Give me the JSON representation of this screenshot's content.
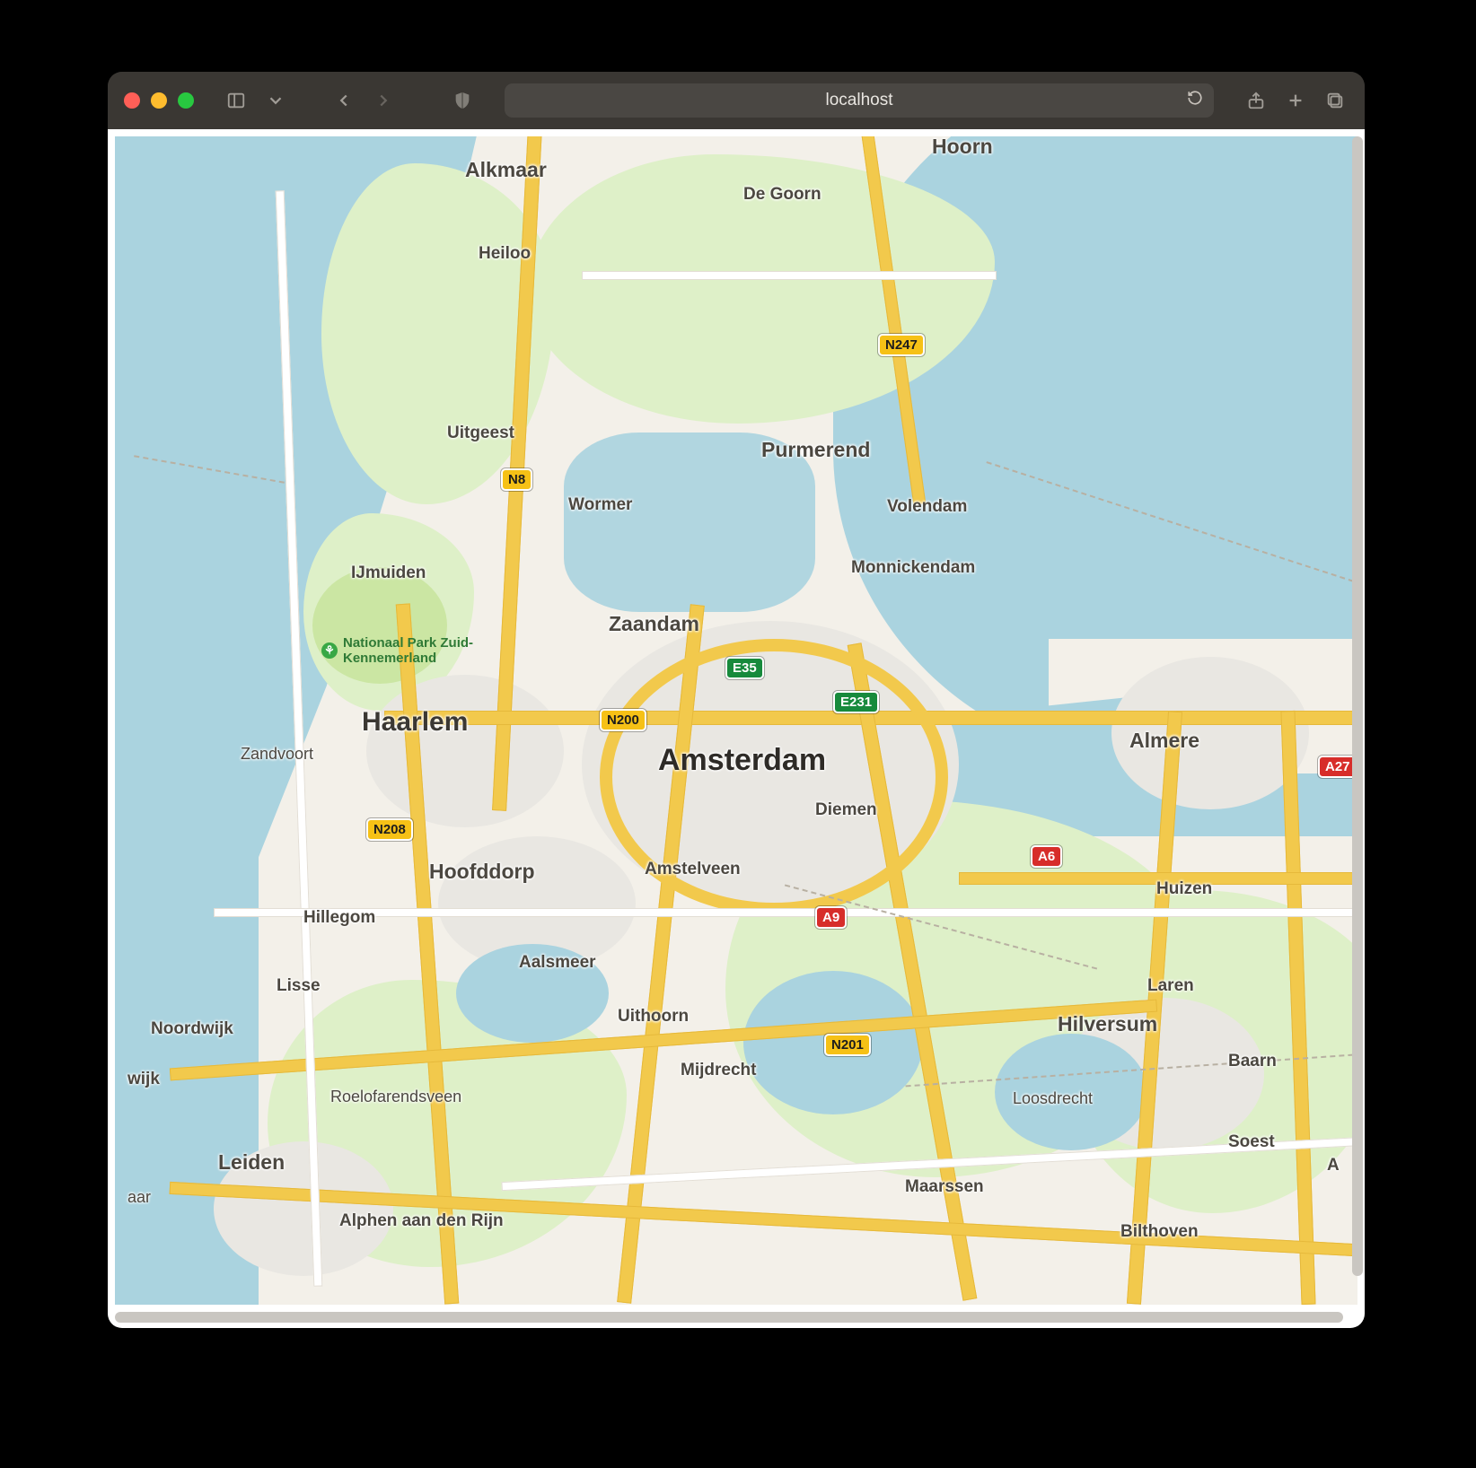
{
  "browser": {
    "address": "localhost",
    "traffic_lights": {
      "close": "close",
      "min": "minimize",
      "max": "maximize"
    }
  },
  "map": {
    "center_label": "Amsterdam",
    "poi": {
      "nationaal_park": "Nationaal Park Zuid-\nKennemerland"
    },
    "cities": {
      "amsterdam": "Amsterdam",
      "haarlem": "Haarlem",
      "almere": "Almere",
      "hilversum": "Hilversum",
      "leiden": "Leiden",
      "zaandam": "Zaandam",
      "purmerend": "Purmerend",
      "hoorn": "Hoorn",
      "alkmaar": "Alkmaar",
      "heiloo": "Heiloo",
      "uitgeest": "Uitgeest",
      "wormer": "Wormer",
      "degoorn": "De Goorn",
      "volendam": "Volendam",
      "monnickendam": "Monnickendam",
      "ijmuiden": "IJmuiden",
      "zandvoort": "Zandvoort",
      "hoofddorp": "Hoofddorp",
      "amstelveen": "Amstelveen",
      "diemen": "Diemen",
      "hillegom": "Hillegom",
      "lisse": "Lisse",
      "noordwijk": "Noordwijk",
      "wijk": "wijk",
      "aar": "aar",
      "roelofarendsveen": "Roelofarendsveen",
      "alphen": "Alphen aan den Rijn",
      "aalsmeer": "Aalsmeer",
      "uithoorn": "Uithoorn",
      "mijdrecht": "Mijdrecht",
      "maarssen": "Maarssen",
      "bilthoven": "Bilthoven",
      "soest": "Soest",
      "a_cut": "A",
      "baarn": "Baarn",
      "laren": "Laren",
      "huizen": "Huizen",
      "loosdrecht": "Loosdrecht",
      "n247": "N247",
      "n8": "N8",
      "n200": "N200",
      "n208": "N208",
      "n201": "N201",
      "e35": "E35",
      "e231": "E231",
      "a6": "A6",
      "a9": "A9",
      "a27": "A27"
    }
  }
}
